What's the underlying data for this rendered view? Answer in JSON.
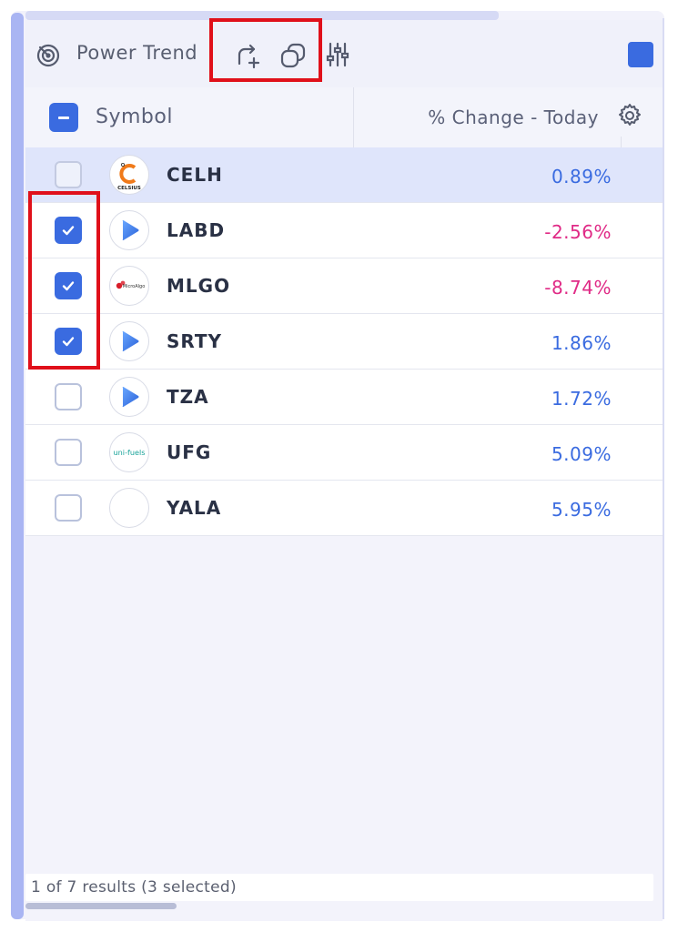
{
  "toolbar": {
    "title": "Power Trend",
    "accent_color": "#3a6be0",
    "icons": [
      "radar-icon",
      "share-add-icon",
      "copy-shapes-icon",
      "sliders-icon"
    ]
  },
  "table": {
    "header": {
      "symbol_label": "Symbol",
      "change_label": "% Change - Today",
      "select_all_state": "indeterminate"
    },
    "rows": [
      {
        "ticker": "CELH",
        "change": "0.89%",
        "checked": false,
        "highlighted": true,
        "logo": "celsius-logo",
        "logo_text": "CELSIUS"
      },
      {
        "ticker": "LABD",
        "change": "-2.56%",
        "checked": true,
        "highlighted": false,
        "logo": "play-triangle-logo"
      },
      {
        "ticker": "MLGO",
        "change": "-8.74%",
        "checked": true,
        "highlighted": false,
        "logo": "microalgo-logo",
        "logo_text": "MicroAlgo"
      },
      {
        "ticker": "SRTY",
        "change": "1.86%",
        "checked": true,
        "highlighted": false,
        "logo": "play-triangle-logo"
      },
      {
        "ticker": "TZA",
        "change": "1.72%",
        "checked": false,
        "highlighted": false,
        "logo": "play-triangle-logo"
      },
      {
        "ticker": "UFG",
        "change": "5.09%",
        "checked": false,
        "highlighted": false,
        "logo": "unifuels-logo",
        "logo_text": "uni-fuels"
      },
      {
        "ticker": "YALA",
        "change": "5.95%",
        "checked": false,
        "highlighted": false,
        "logo": "blank-logo"
      }
    ]
  },
  "footer": {
    "results_text": "1 of 7 results (3 selected)"
  },
  "colors": {
    "positive": "#3a6be0",
    "negative": "#e02a86",
    "highlight_row": "#dfe5fb",
    "annotation_red": "#e0101a"
  }
}
